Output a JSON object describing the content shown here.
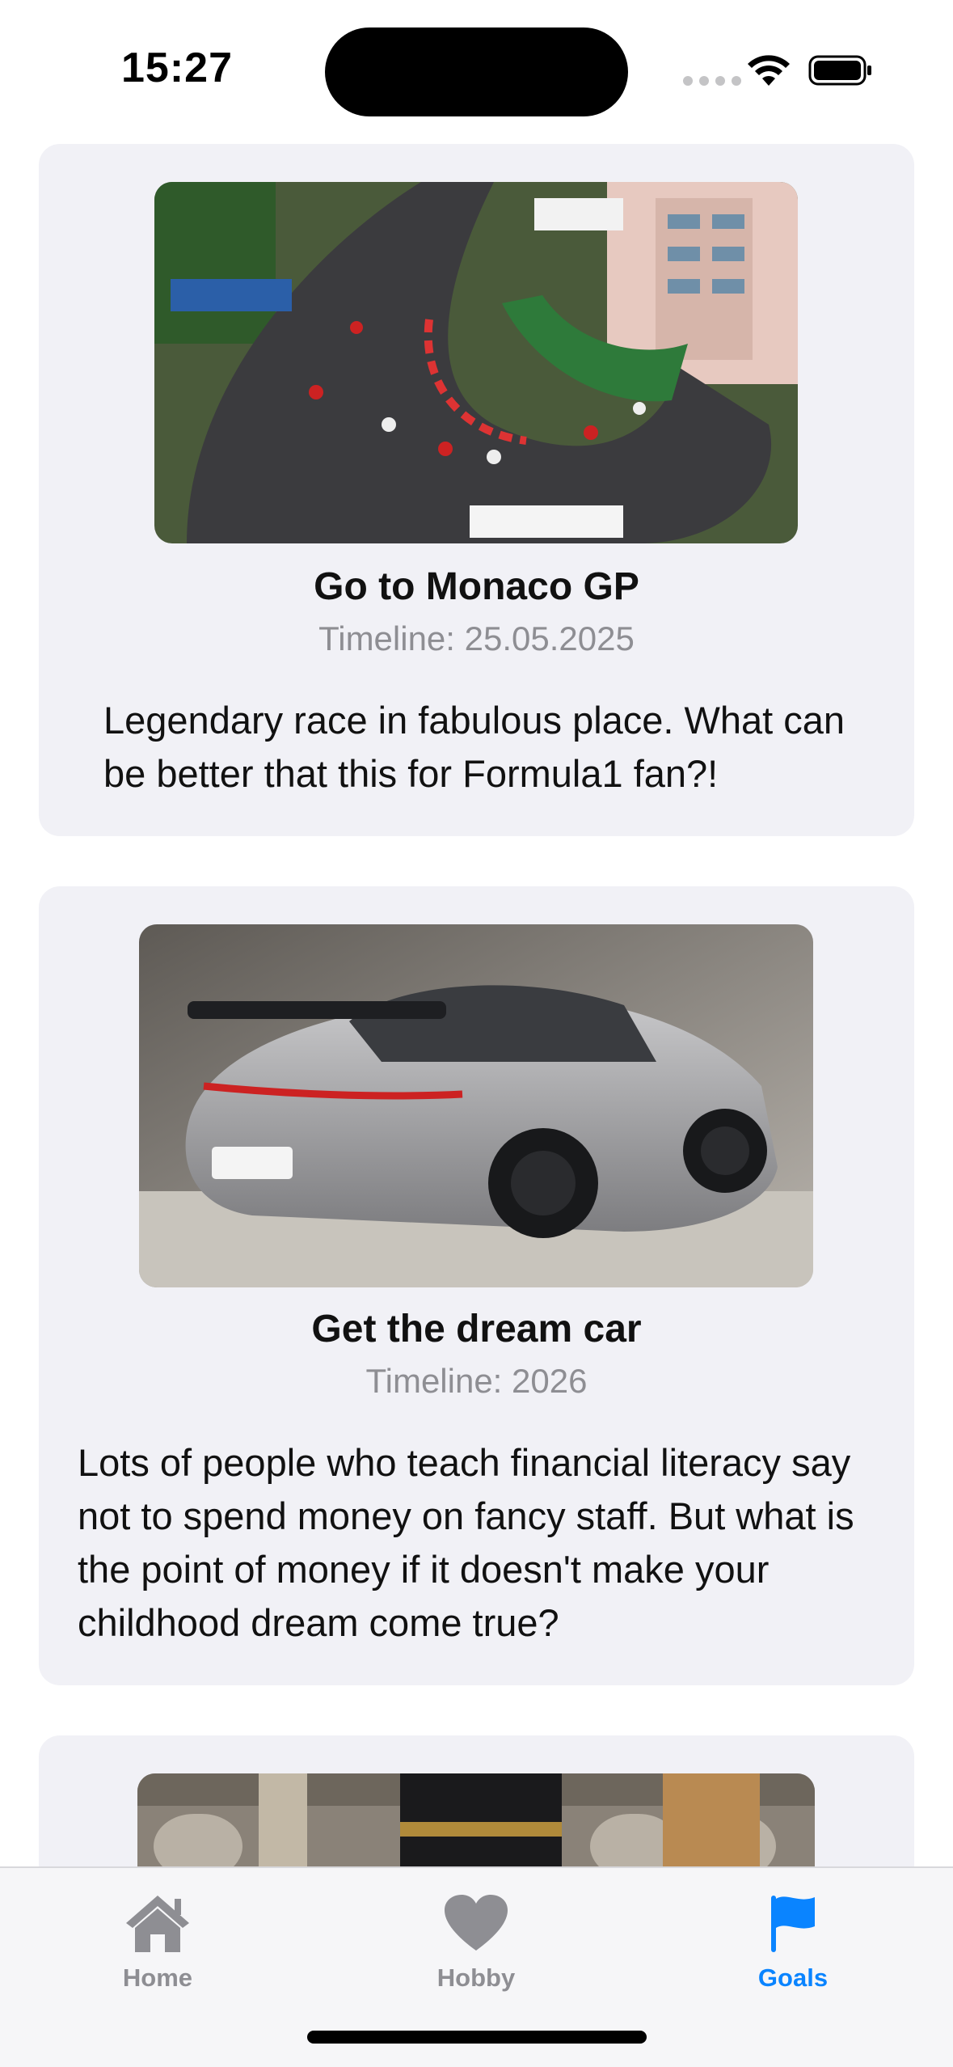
{
  "status_bar": {
    "time": "15:27",
    "icons": [
      "cellular-signal-icon",
      "wifi-icon",
      "battery-icon"
    ]
  },
  "goals": [
    {
      "title": "Go to Monaco GP",
      "timeline": "Timeline: 25.05.2025",
      "description": "Legendary race in fabulous place. What can be better that this for Formula1 fan?!",
      "image": "monaco-grand-prix-hairpin-photo"
    },
    {
      "title": "Get the dream car",
      "timeline": "Timeline: 2026",
      "description": "Lots of people who teach financial literacy say not to spend money on fancy staff. But what is the point of money if it doesn't make your childhood dream come true?",
      "image": "silver-sports-car-photo"
    },
    {
      "title": "",
      "timeline": "",
      "description": "",
      "image": "mosque-kaaba-photo"
    }
  ],
  "tab_bar": {
    "tabs": [
      {
        "label": "Home",
        "icon": "house-icon",
        "active": false
      },
      {
        "label": "Hobby",
        "icon": "heart-icon",
        "active": false
      },
      {
        "label": "Goals",
        "icon": "flag-icon",
        "active": true
      }
    ],
    "active_color": "#0a84ff",
    "inactive_color": "#8e8e93"
  }
}
